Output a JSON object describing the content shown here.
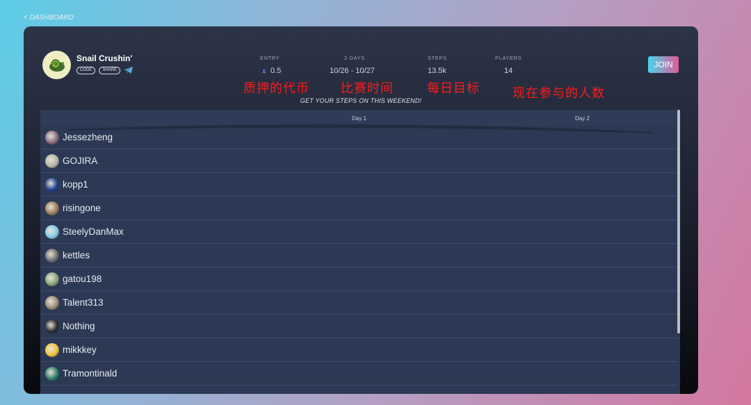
{
  "nav": {
    "back_label": "< DASHBOARD"
  },
  "challenge": {
    "name": "Snail Crushin'",
    "code_label": "CODE",
    "share_label": "SHARE",
    "join_label": "JOIN",
    "tagline": "GET YOUR STEPS ON THIS WEEKEND!"
  },
  "stats": {
    "entry": {
      "label": "ENTRY",
      "value": "0.5"
    },
    "days": {
      "label": "2 DAYS",
      "value": "10/26 - 10/27"
    },
    "steps": {
      "label": "STEPS",
      "value": "13.5k"
    },
    "players": {
      "label": "PLAYERS",
      "value": "14"
    }
  },
  "annotations": {
    "entry": "质押的代币",
    "days": "比赛时间",
    "steps": "每日目标",
    "players": "现在参与的人数"
  },
  "board": {
    "columns": [
      "Day 1",
      "Day 2"
    ],
    "players": [
      {
        "name": "Jessezheng",
        "color": "#8a6a7a"
      },
      {
        "name": "GOJIRA",
        "color": "#b6b2a6"
      },
      {
        "name": "kopp1",
        "color": "#1f3f8f"
      },
      {
        "name": "risingone",
        "color": "#9a7b5e"
      },
      {
        "name": "SteelyDanMax",
        "color": "#7fcbe6"
      },
      {
        "name": "kettles",
        "color": "#6e6e6e"
      },
      {
        "name": "gatou198",
        "color": "#8aa37a"
      },
      {
        "name": "Talent313",
        "color": "#9c8a78"
      },
      {
        "name": "Nothing",
        "color": "#2a2a2a"
      },
      {
        "name": "mikkkey",
        "color": "#f0c33a"
      },
      {
        "name": "Tramontinald",
        "color": "#2f7f6a"
      }
    ]
  },
  "colors": {
    "accent_start": "#47d6ee",
    "accent_end": "#e05b9a",
    "annotation": "#ff1a1a"
  }
}
